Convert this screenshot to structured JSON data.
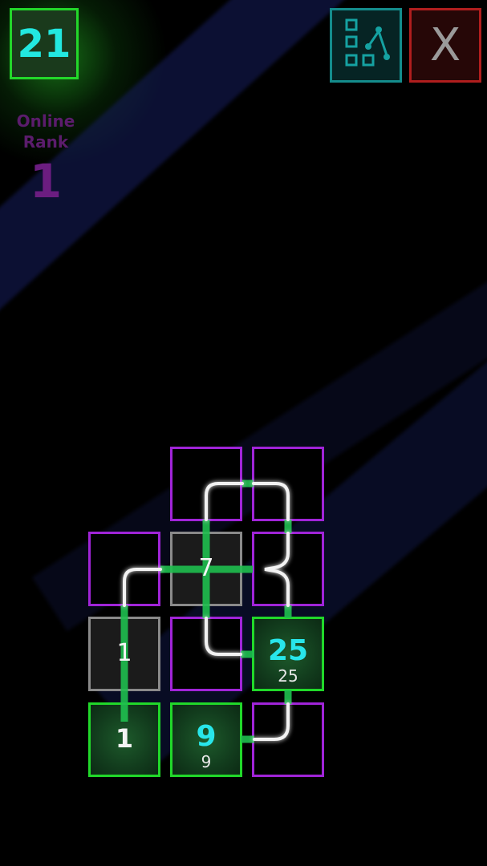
{
  "score": {
    "value": "21"
  },
  "online_rank": {
    "label": "Online\nRank",
    "value": "1"
  },
  "toolbar": {
    "levels_icon": "level-map-icon",
    "close_label": "X"
  },
  "board": {
    "tiles": [
      {
        "id": "r0c1",
        "kind": "pipe",
        "text": ""
      },
      {
        "id": "r0c2",
        "kind": "pipe",
        "text": ""
      },
      {
        "id": "r1c0",
        "kind": "pipe",
        "text": ""
      },
      {
        "id": "r1c1",
        "kind": "node",
        "text": "7"
      },
      {
        "id": "r1c2",
        "kind": "pipe",
        "text": ""
      },
      {
        "id": "r2c0",
        "kind": "node",
        "text": "1"
      },
      {
        "id": "r2c1",
        "kind": "pipe",
        "text": ""
      },
      {
        "id": "r2c2",
        "kind": "target",
        "text": "25",
        "sub": "25"
      },
      {
        "id": "r3c0",
        "kind": "target",
        "text": "1"
      },
      {
        "id": "r3c1",
        "kind": "target",
        "text": "9",
        "sub": "9"
      },
      {
        "id": "r3c2",
        "kind": "pipe",
        "text": ""
      }
    ]
  },
  "colors": {
    "accent_green": "#21d82a",
    "accent_purple": "#a024d8",
    "accent_cyan": "#28e6ea",
    "close_red": "#b01e1e"
  }
}
